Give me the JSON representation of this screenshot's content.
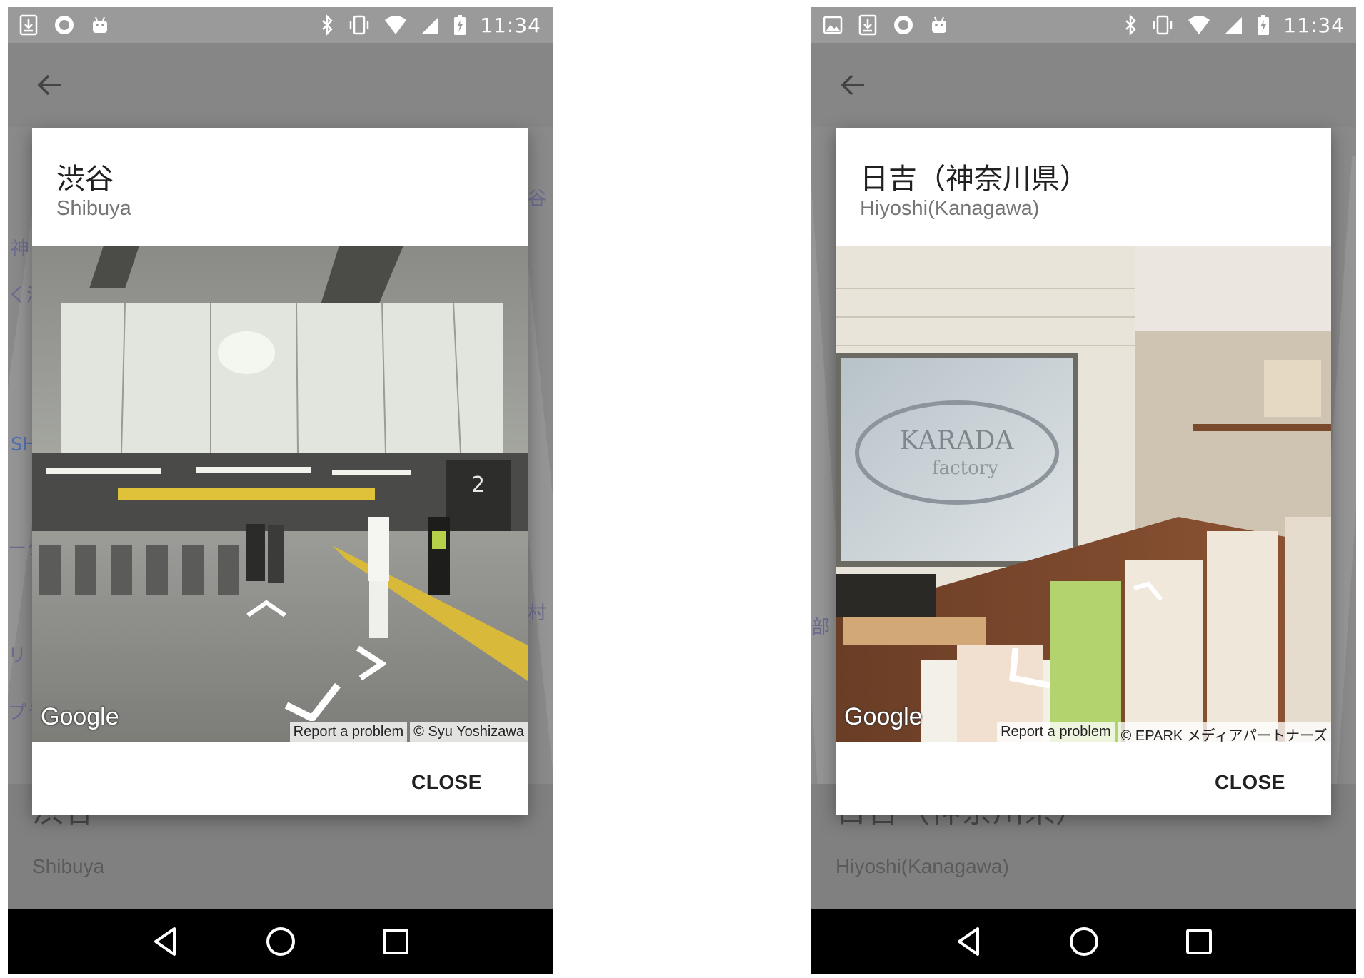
{
  "status_bar": {
    "time": "11:34"
  },
  "screens": [
    {
      "dialog": {
        "title": "渋谷",
        "subtitle": "Shibuya",
        "google_label": "Google",
        "report_label": "Report a problem",
        "credit": "© Syu Yoshizawa",
        "close_label": "CLOSE"
      },
      "sheet": {
        "title": "渋谷",
        "subtitle": "Shibuya"
      }
    },
    {
      "dialog": {
        "title": "日吉（神奈川県）",
        "subtitle": "Hiyoshi(Kanagawa)",
        "google_label": "Google",
        "report_label": "Report a problem",
        "credit": "© EPARK メディアパートナーズ",
        "close_label": "CLOSE"
      },
      "sheet": {
        "title": "日吉（神奈川県）",
        "subtitle": "Hiyoshi(Kanagawa)"
      }
    }
  ],
  "icons": [
    "download-icon",
    "shield-icon",
    "android-icon",
    "image-icon",
    "bluetooth-icon",
    "vibrate-icon",
    "wifi-icon",
    "signal-icon",
    "battery-icon",
    "back-arrow-icon",
    "nav-back-icon",
    "nav-home-icon",
    "nav-recents-icon"
  ],
  "colors": {
    "scrim": "#7d7d7d",
    "dialog": "#ffffff",
    "nav_bar": "#000000"
  }
}
